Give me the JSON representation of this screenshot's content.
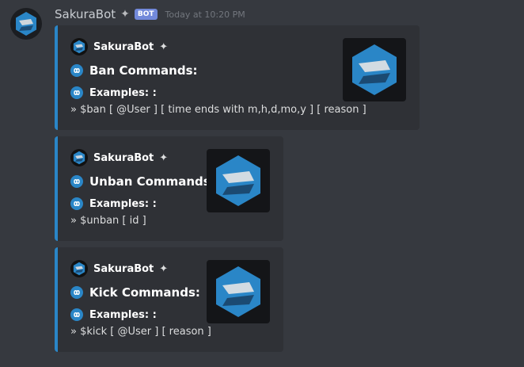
{
  "message": {
    "username": "SakuraBot",
    "bot_tag": "BOT",
    "timestamp": "Today at 10:20 PM",
    "avatar_icon": "sakura-logo-icon"
  },
  "embeds": [
    {
      "author": "SakuraBot",
      "title": "Ban Commands:",
      "field_name": "Examples: :",
      "field_value": "» $ban [ @User ] [ time ends with m,h,d,mo,y ] [ reason ]",
      "accent_color": "#2a86c7"
    },
    {
      "author": "SakuraBot",
      "title": "Unban Commands:",
      "field_name": "Examples: :",
      "field_value": "» $unban [ id ]",
      "accent_color": "#2a86c7"
    },
    {
      "author": "SakuraBot",
      "title": "Kick Commands:",
      "field_name": "Examples: :",
      "field_value": "» $kick [ @User ] [ reason ]",
      "accent_color": "#2a86c7"
    }
  ],
  "colors": {
    "background": "#36393f",
    "embed_background": "#2f3136",
    "bot_tag": "#7289da",
    "timestamp": "#72767d"
  }
}
